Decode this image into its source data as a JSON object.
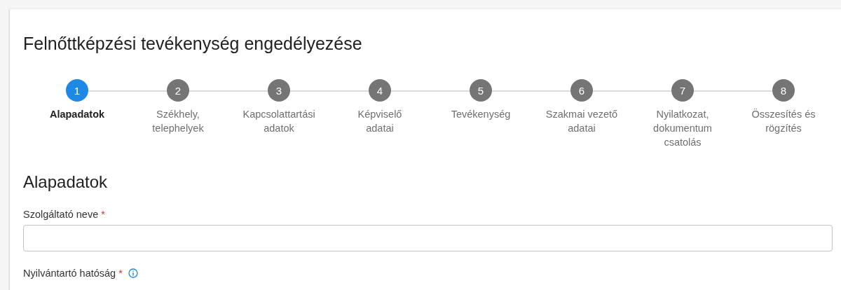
{
  "title": "Felnőttképzési tevékenység engedélyezése",
  "steps": [
    {
      "number": "1",
      "label": "Alapadatok",
      "selected": true
    },
    {
      "number": "2",
      "label": "Székhely, telephelyek",
      "selected": false
    },
    {
      "number": "3",
      "label": "Kapcsolattartási adatok",
      "selected": false
    },
    {
      "number": "4",
      "label": "Képviselő adatai",
      "selected": false
    },
    {
      "number": "5",
      "label": "Tevékenység",
      "selected": false
    },
    {
      "number": "6",
      "label": "Szakmai vezető adatai",
      "selected": false
    },
    {
      "number": "7",
      "label": "Nyilatkozat, dokumentum csatolás",
      "selected": false
    },
    {
      "number": "8",
      "label": "Összesítés és rögzítés",
      "selected": false
    }
  ],
  "section_title": "Alapadatok",
  "fields": [
    {
      "label": "Szolgáltató neve",
      "required_mark": "*",
      "info": false
    },
    {
      "label": "Nyilvántartó hatóság",
      "required_mark": "*",
      "info": true
    }
  ]
}
